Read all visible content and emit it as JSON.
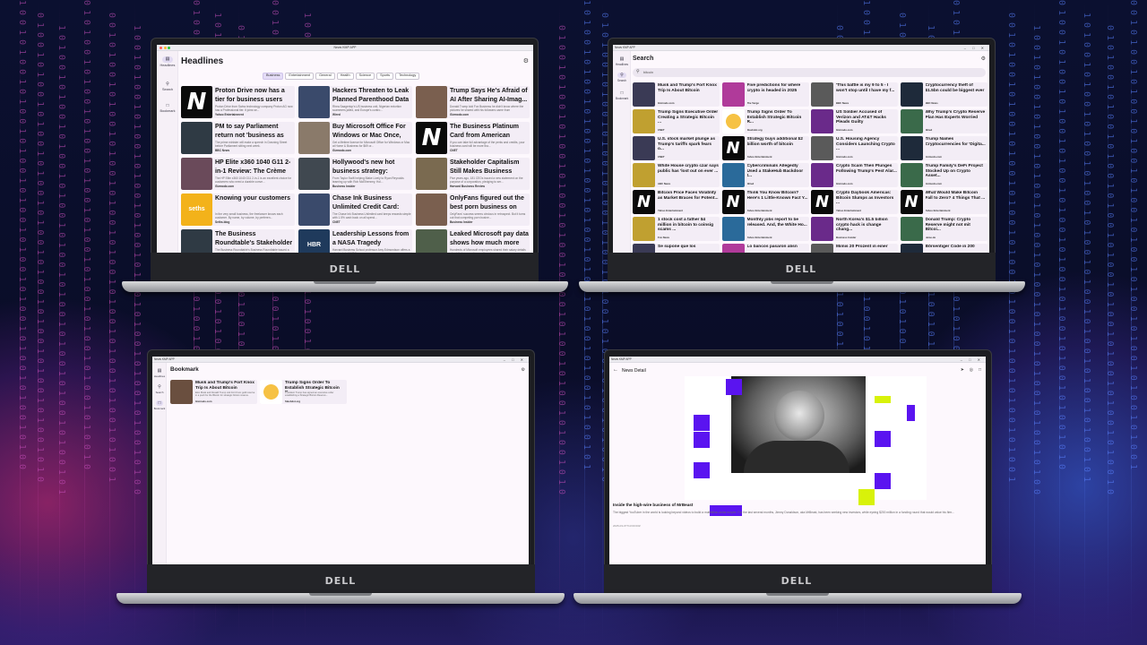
{
  "app_title": "News KMP APP",
  "colors": {
    "accent": "#e4dcf6",
    "screen_bg": "#fdf8fd",
    "card_bg": "#f3edf6",
    "brand_purple": "#5a14f0",
    "brand_lime": "#d8f20a"
  },
  "nav": {
    "headlines": "Headlines",
    "search": "Search",
    "bookmark": "Bookmark"
  },
  "headlines": {
    "title": "Headlines",
    "chips": [
      "Business",
      "Entertainment",
      "General",
      "Health",
      "Science",
      "Sports",
      "Technology"
    ],
    "selected_chip": "Business",
    "cards": [
      {
        "title": "Proton Drive now has a tier for business users",
        "desc": "Proton Drive from Swiss technology company Proton AG now has a Professional tier. It joins se...",
        "source": "Yahoo Entertainment",
        "thumb": "n-logo"
      },
      {
        "title": "Hackers Threaten to Leak Planned Parenthood Data",
        "desc": "Rhea Saagertop's US business unit, Nigerian extortion scammers jailed, and Europe's contro...",
        "source": "Wired",
        "thumb": "photo"
      },
      {
        "title": "Trump Says He's Afraid of AI After Sharing AI-Imag...",
        "desc": "Donald Trump told Fox Business he didn't know where the pictures he shared with his followers came from",
        "source": "Gizmodo.com",
        "thumb": "photo"
      },
      {
        "title": "PM to say Parliament return not 'business as u...",
        "desc": "The prime minister will make a speech in Downing Street before Parliament sitting next week.",
        "source": "BBC News",
        "thumb": "photo"
      },
      {
        "title": "Buy Microsoft Office For Windows or Mac Once, U...",
        "desc": "Get a lifetime license for Microsoft Office for Windows or Mac at Home & Business for $69 or...",
        "source": "Gizmodo.com",
        "thumb": "photo"
      },
      {
        "title": "The Business Platinum Card from American Expr...",
        "desc": "If you can take full advantage of the perks and credits, your business card will be more tha...",
        "source": "CNET",
        "thumb": "n-logo"
      },
      {
        "title": "HP Elite x360 1040 G11 2-in-1 Review: The Crème d...",
        "desc": "The HP Elite x360 1040 G11 2-in-1 is an excellent choice for customers who need a durable conve...",
        "source": "Gizmodo.com",
        "thumb": "photo"
      },
      {
        "title": "Hollywood's new hot business strategy: Celeb...",
        "desc": "From Taylor Swift helping Blake Lively to Ryan Reynolds teaming up with Rob McElhenney, Hol...",
        "source": "Business Insider",
        "thumb": "photo"
      },
      {
        "title": "Stakeholder Capitalism Still Makes Business Sense",
        "desc": "Five years ago, 181 CEOs issued a new statement on the purpose of a corporation, pledging to ser...",
        "source": "Harvard Business Review",
        "thumb": "photo"
      },
      {
        "title": "Knowing your customers",
        "desc": "In the very small business, the freelancer knows each customer. By name, by volume, by preferen...",
        "source": "Seths.blog",
        "thumb": "seths"
      },
      {
        "title": "Chase Ink Business Unlimited Credit Card: Ea...",
        "desc": "The Chase Ink Business Unlimited card keeps rewards simple with 1.5% cash back on all spend...",
        "source": "CNET",
        "thumb": "photo"
      },
      {
        "title": "OnlyFans figured out the best porn business on th...",
        "desc": "OnlyFans' success seems obvious in retrospect. But it turns out that competing porn busine...",
        "source": "Business Insider",
        "thumb": "photo"
      },
      {
        "title": "The Business Roundtable's Stakeholder Pledge, Five ...",
        "desc": "The Business Roundtable's Business Roundtable issued a statement pledging to 'lead their companies for the...",
        "source": "",
        "thumb": "photo"
      },
      {
        "title": "Leadership Lessons from a NASA Tragedy",
        "desc": "Harvard Business School professor Amy Edmondson offers a window into NASA's...",
        "source": "",
        "thumb": "hbr"
      },
      {
        "title": "Leaked Microsoft pay data shows how much more AI...",
        "desc": "Hundreds of Microsoft employees shared their salary details about their pay and promotions in a survey...",
        "source": "",
        "thumb": "photo"
      }
    ]
  },
  "search": {
    "title": "Search",
    "query": "bitcoin",
    "cards": [
      {
        "title": "Musk and Trump's Fort Knox Trip Is About Bitcoin",
        "source": "Gizmodo.com"
      },
      {
        "title": "Five predictions for where crypto is headed in 2025",
        "source": "The Verge"
      },
      {
        "title": "'This battle is my 9 to 5 - I won't stop until I have my f...",
        "source": "BBC News"
      },
      {
        "title": "Cryptocurrency theft of $1.5bn could be biggest ever",
        "source": "BBC News"
      },
      {
        "title": "Trump Signs Executive Order Creating a Strategic Bitcoin ...",
        "source": "CNET"
      },
      {
        "title": "Trump Signs Order To Establish Strategic Bitcoin R...",
        "source": "Slashdot.org"
      },
      {
        "title": "US Soldier Accused of Verizon and AT&T Hacks Pleads Guilty",
        "source": "Gizmodo.com"
      },
      {
        "title": "Why Trump's Crypto Reserve Plan Has Experts Worried",
        "source": "Wired"
      },
      {
        "title": "U.S. stock market plunge as Trump's tariffs spark fears o...",
        "source": "CNET"
      },
      {
        "title": "Strategy buys additional $2 billion worth of bitcoin",
        "source": "Yahoo Entertainment"
      },
      {
        "title": "U.S. Housing Agency Considers Launching Crypto ...",
        "source": "Gizmodo.com"
      },
      {
        "title": "Trump Names Cryptocurrencies for 'Digita...",
        "source": "Gizmodo.com"
      },
      {
        "title": "White House crypto czar says public has 'lost out on ever ...",
        "source": "ABC News"
      },
      {
        "title": "Cybercriminals Allegedly Used a StakeHub Backdoor t...",
        "source": "Wired"
      },
      {
        "title": "Crypto Scam Then Plunges Following Trump's Pest Alar...",
        "source": "Gizmodo.com"
      },
      {
        "title": "Trump Family's DeFi Project Stocked Up on Crypto Asset...",
        "source": "Gizmodo.com"
      },
      {
        "title": "Bitcoin Price Faces Volatility as Market Braces for Potent...",
        "source": "Yahoo Entertainment"
      },
      {
        "title": "Think You Know Bitcoin? Here's 1 Little-Known Fact Y...",
        "source": "Yahoo Entertainment"
      },
      {
        "title": "Crypto Daybook Americas: Bitcoin Slumps as Investors ...",
        "source": "Yahoo Entertainment"
      },
      {
        "title": "What Would Make Bitcoin Fall to Zero? 4 Things That ...",
        "source": "Yahoo Entertainment"
      },
      {
        "title": "1 stock cost a father $4 million in bitcoin to coinsig scams ...",
        "source": "Fox News"
      },
      {
        "title": "Monthly jobs report to be released. And, the White Ho...",
        "source": "Yahoo Entertainment"
      },
      {
        "title": "North Korea's $1.5 billion crypto hack is change chang...",
        "source": "Business Insider"
      },
      {
        "title": "Donald Trump: Crypto Reserve might not mit Bitcoi...",
        "source": "Heise.de"
      },
      {
        "title": "Se supone que los",
        "source": ""
      },
      {
        "title": "Lo bancos pasaron alisn",
        "source": ""
      },
      {
        "title": "Mimis 20 Prozent in einer",
        "source": ""
      },
      {
        "title": "Börsentiger Code in 200",
        "source": ""
      }
    ]
  },
  "bookmark": {
    "title": "Bookmark",
    "cards": [
      {
        "title": "Musk and Trump's Fort Knox Trip Is About Bitcoin",
        "desc": "Elon Musk and Donald Trump visit Fort Knox gold reserve in a push for the Bitcoin for strategic bitcoin reserve.",
        "source": "Gizmodo.com"
      },
      {
        "title": "Trump Signs Order To Establish Strategic Bitcoin R...",
        "desc": "President Trump has signed an executive order establishing a Strategic Bitcoin Reserve...",
        "source": "Slashdot.org"
      }
    ]
  },
  "detail": {
    "title": "News Detail",
    "article_title": "Inside the high-wire business of MrBeast",
    "body": "The biggest YouTuber in the world is looking beyond videos to build a multibillion-dollar empire. For the last several months, Jimmy Donaldson, aka MrBeast, has been seeking new investors, while eyeing $200 million in a funding round that would value his firm...",
    "date": "2025-03-07T13:00:00Z"
  },
  "brand": "DELL"
}
